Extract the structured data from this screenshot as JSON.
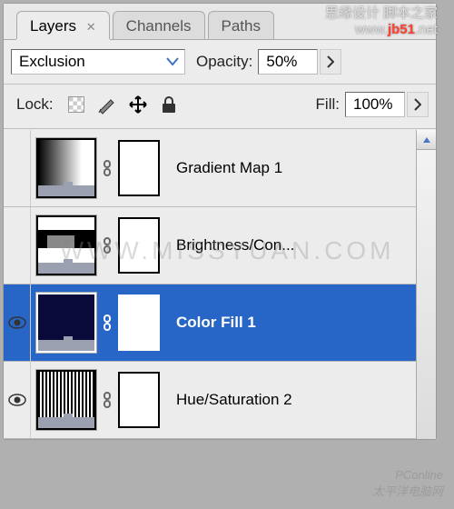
{
  "tabs": {
    "layers": "Layers",
    "channels": "Channels",
    "paths": "Paths"
  },
  "options": {
    "blend_mode": "Exclusion",
    "opacity_label": "Opacity:",
    "opacity_value": "50%",
    "lock_label": "Lock:",
    "fill_label": "Fill:",
    "fill_value": "100%"
  },
  "layers": {
    "r0": {
      "name": "Gradient Map 1",
      "visible": false,
      "selected": false
    },
    "r1": {
      "name": "Brightness/Con...",
      "visible": false,
      "selected": false
    },
    "r2": {
      "name": "Color Fill 1",
      "visible": true,
      "selected": true
    },
    "r3": {
      "name": "Hue/Saturation 2",
      "visible": true,
      "selected": false
    }
  },
  "watermarks": {
    "top_line1": "思缘设计 脚本之家",
    "top_line2_1": "www.",
    "top_line2_2": "jb51",
    "top_line2_3": ".net",
    "center": "WWW.MISSYUAN.COM",
    "bottom1": "PConline",
    "bottom2": "太平洋电脑网"
  }
}
